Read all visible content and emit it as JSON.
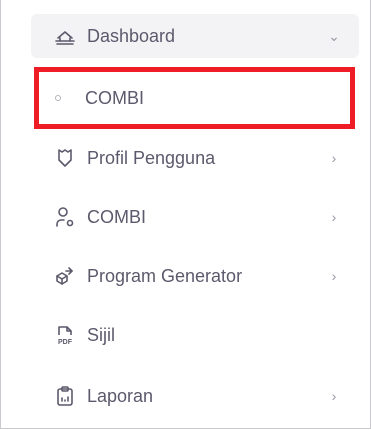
{
  "menu": {
    "dashboard": {
      "label": "Dashboard",
      "icon": "smart-home-icon",
      "chevron": "chevron-down-icon"
    },
    "submenu": {
      "label": "COMBI",
      "icon": "circle-bullet-icon",
      "highlight_color": "#ee1c25"
    },
    "items": [
      {
        "label": "Profil Pengguna",
        "icon": "shield-icon",
        "chevron": "chevron-right-icon"
      },
      {
        "label": "COMBI",
        "icon": "user-cog-icon",
        "chevron": "chevron-right-icon"
      },
      {
        "label": "Program Generator",
        "icon": "cube-send-icon",
        "chevron": "chevron-right-icon"
      },
      {
        "label": "Sijil",
        "icon": "pdf-file-icon",
        "chevron": ""
      },
      {
        "label": "Laporan",
        "icon": "clipboard-report-icon",
        "chevron": "chevron-right-icon"
      }
    ]
  }
}
